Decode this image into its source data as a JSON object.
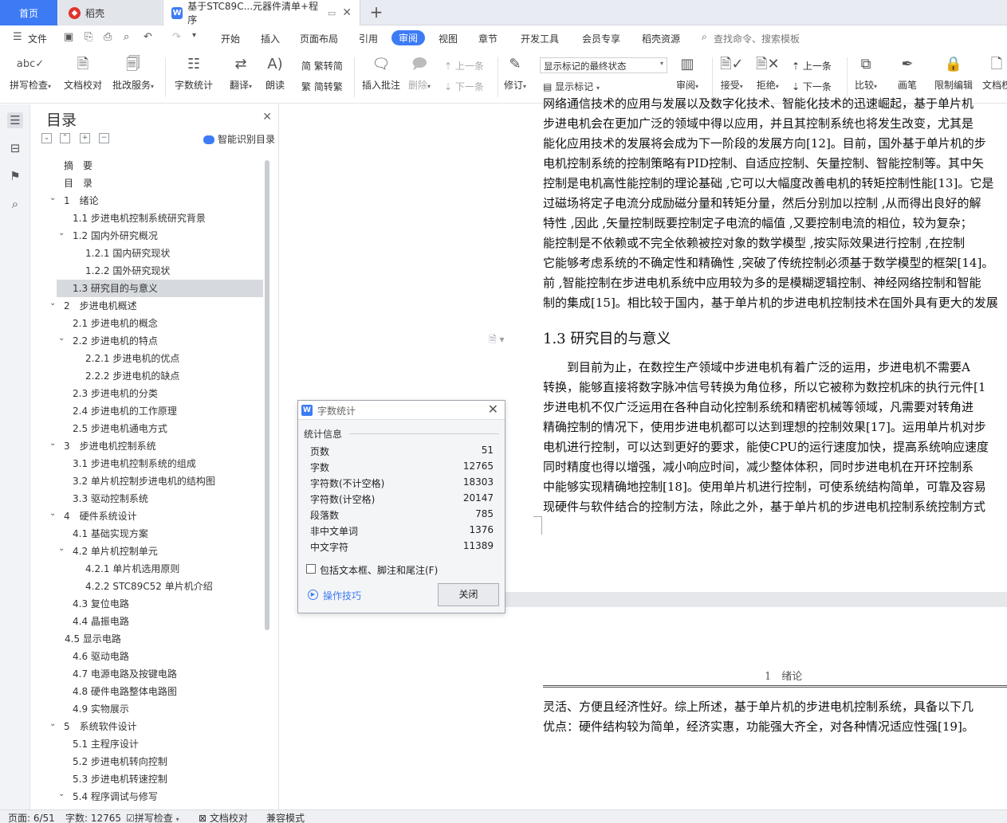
{
  "tabs": {
    "home": "首页",
    "daoke": "稻壳",
    "document": "基于STC89C...元器件清单+程序",
    "new_tab": "+"
  },
  "menu": {
    "file": "文件",
    "items": [
      "开始",
      "插入",
      "页面布局",
      "引用",
      "审阅",
      "视图",
      "章节",
      "开发工具",
      "会员专享",
      "稻壳资源"
    ],
    "active": "审阅",
    "search": "查找命令、搜索模板"
  },
  "ribbon": {
    "spell_check": "拼写检查",
    "doc_check": "文档校对",
    "annotate_service": "批改服务",
    "word_count": "字数统计",
    "translate": "翻译",
    "read_aloud": "朗读",
    "trad": "繁转简",
    "simp": "简转繁",
    "insert_comment": "插入批注",
    "delete": "删除",
    "prev_comment": "上一条",
    "next_comment": "下一条",
    "track": "修订",
    "markup_state": "显示标记的最终状态",
    "show_markup": "显示标记",
    "review": "审阅",
    "accept": "接受",
    "reject": "拒绝",
    "prev_change": "上一条",
    "next_change": "下一条",
    "compare": "比较",
    "pen": "画笔",
    "restrict_edit": "限制编辑",
    "doc_right": "文档权"
  },
  "toc": {
    "title": "目录",
    "smart": "智能识别目录",
    "items": [
      {
        "label": "摘　要",
        "indent": 0,
        "arrow": ""
      },
      {
        "label": "目　录",
        "indent": 0,
        "arrow": ""
      },
      {
        "label": "1　绪论",
        "indent": 0,
        "arrow": "v"
      },
      {
        "label": "1.1  步进电机控制系统研究背景",
        "indent": 1,
        "arrow": ""
      },
      {
        "label": "1.2  国内外研究概况",
        "indent": 1,
        "arrow": "v"
      },
      {
        "label": "1.2.1  国内研究现状",
        "indent": 2,
        "arrow": ""
      },
      {
        "label": "1.2.2  国外研究现状",
        "indent": 2,
        "arrow": ""
      },
      {
        "label": "1.3  研究目的与意义",
        "indent": 1,
        "arrow": "",
        "selected": true
      },
      {
        "label": "2　步进电机概述",
        "indent": 0,
        "arrow": "v"
      },
      {
        "label": "2.1  步进电机的概念",
        "indent": 1,
        "arrow": ""
      },
      {
        "label": "2.2  步进电机的特点",
        "indent": 1,
        "arrow": "v"
      },
      {
        "label": "2.2.1  步进电机的优点",
        "indent": 2,
        "arrow": ""
      },
      {
        "label": "2.2.2  步进电机的缺点",
        "indent": 2,
        "arrow": ""
      },
      {
        "label": "2.3  步进电机的分类",
        "indent": 1,
        "arrow": ""
      },
      {
        "label": "2.4  步进电机的工作原理",
        "indent": 1,
        "arrow": ""
      },
      {
        "label": "2.5  步进电机通电方式",
        "indent": 1,
        "arrow": ""
      },
      {
        "label": "3　步进电机控制系统",
        "indent": 0,
        "arrow": "v"
      },
      {
        "label": "3.1  步进电机控制系统的组成",
        "indent": 1,
        "arrow": ""
      },
      {
        "label": "3.2 单片机控制步进电机的结构图",
        "indent": 1,
        "arrow": ""
      },
      {
        "label": "3.3  驱动控制系统",
        "indent": 1,
        "arrow": ""
      },
      {
        "label": "4　硬件系统设计",
        "indent": 0,
        "arrow": "v"
      },
      {
        "label": "4.1  基础实现方案",
        "indent": 1,
        "arrow": ""
      },
      {
        "label": "4.2  单片机控制单元",
        "indent": 1,
        "arrow": "v"
      },
      {
        "label": "4.2.1  单片机选用原则",
        "indent": 2,
        "arrow": ""
      },
      {
        "label": "4.2.2 STC89C52 单片机介绍",
        "indent": 2,
        "arrow": ""
      },
      {
        "label": "4.3  复位电路",
        "indent": 1,
        "arrow": ""
      },
      {
        "label": "4.4  晶振电路",
        "indent": 1,
        "arrow": ""
      },
      {
        "label": "4.5  显示电路",
        "indent": 1,
        "arrow": "",
        "extra": true
      },
      {
        "label": "4.6  驱动电路",
        "indent": 1,
        "arrow": ""
      },
      {
        "label": "4.7  电源电路及按键电路",
        "indent": 1,
        "arrow": ""
      },
      {
        "label": "4.8  硬件电路整体电路图",
        "indent": 1,
        "arrow": ""
      },
      {
        "label": "4.9  实物展示",
        "indent": 1,
        "arrow": ""
      },
      {
        "label": "5　系统软件设计",
        "indent": 0,
        "arrow": "v"
      },
      {
        "label": "5.1  主程序设计",
        "indent": 1,
        "arrow": ""
      },
      {
        "label": "5.2  步进电机转向控制",
        "indent": 1,
        "arrow": ""
      },
      {
        "label": "5.3  步进电机转速控制",
        "indent": 1,
        "arrow": ""
      },
      {
        "label": "5.4  程序调试与修写",
        "indent": 1,
        "arrow": "v"
      }
    ]
  },
  "document": {
    "lines_top": [
      "网络通信技术的应用与发展以及数字化技术、智能化技术的迅速崛起，基于单片机",
      "步进电机会在更加广泛的领域中得以应用，并且其控制系统也将发生改变，尤其是",
      "能化应用技术的发展将会成为下一阶段的发展方向[12]。目前，国外基于单片机的步",
      "电机控制系统的控制策略有PID控制、自适应控制、矢量控制、智能控制等。其中矢",
      "控制是电机高性能控制的理论基础 ,它可以大幅度改善电机的转矩控制性能[13]。它是",
      "过磁场将定子电流分成励磁分量和转矩分量，然后分别加以控制 ,从而得出良好的解",
      "特性 ,因此 ,矢量控制既要控制定子电流的幅值 ,又要控制电流的相位，较为复杂；",
      "能控制是不依赖或不完全依赖被控对象的数学模型 ,按实际效果进行控制 ,在控制",
      "它能够考虑系统的不确定性和精确性 ,突破了传统控制必须基于数学模型的框架[14]。",
      "前 ,智能控制在步进电机系统中应用较为多的是模糊逻辑控制、神经网络控制和智能",
      "制的集成[15]。相比较于国内，基于单片机的步进电机控制技术在国外具有更大的发展"
    ],
    "section_heading": "1.3  研究目的与意义",
    "lines_section": [
      "　　到目前为止，在数控生产领域中步进电机有着广泛的运用，步进电机不需要A",
      "转换，能够直接将数字脉冲信号转换为角位移，所以它被称为数控机床的执行元件[1",
      "步进电机不仅广泛运用在各种自动化控制系统和精密机械等领域，凡需要对转角进",
      "精确控制的情况下，使用步进电机都可以达到理想的控制效果[17]。运用单片机对步",
      "电机进行控制，可以达到更好的要求，能使CPU的运行速度加快，提高系统响应速度",
      "同时精度也得以增强，减小响应时间，减少整体体积，同时步进电机在开环控制系",
      "中能够实现精确地控制[18]。使用单片机进行控制，可使系统结构简单，可靠及容易",
      "现硬件与软件结合的控制方法，除此之外，基于单片机的步进电机控制系统控制方式"
    ],
    "page2_header": "1　绪论",
    "lines_page2": [
      "灵活、方便且经济性好。综上所述，基于单片机的步进电机控制系统，具备以下几",
      "优点：硬件结构较为简单，经济实惠，功能强大齐全，对各种情况适应性强[19]。"
    ]
  },
  "dialog": {
    "title": "字数统计",
    "section": "统计信息",
    "stats": [
      {
        "label": "页数",
        "value": "51"
      },
      {
        "label": "字数",
        "value": "12765"
      },
      {
        "label": "字符数(不计空格)",
        "value": "18303"
      },
      {
        "label": "字符数(计空格)",
        "value": "20147"
      },
      {
        "label": "段落数",
        "value": "785"
      },
      {
        "label": "非中文单词",
        "value": "1376"
      },
      {
        "label": "中文字符",
        "value": "11389"
      }
    ],
    "include_label": "包括文本框、脚注和尾注(F)",
    "tips": "操作技巧",
    "close": "关闭"
  },
  "status": {
    "page": "页面: 6/51",
    "words": "字数: 12765",
    "spell": "拼写检查",
    "doc_check": "文档校对",
    "compat": "兼容模式"
  },
  "colors": {
    "accent": "#3d7bf5",
    "selected": "#d6d9de"
  }
}
